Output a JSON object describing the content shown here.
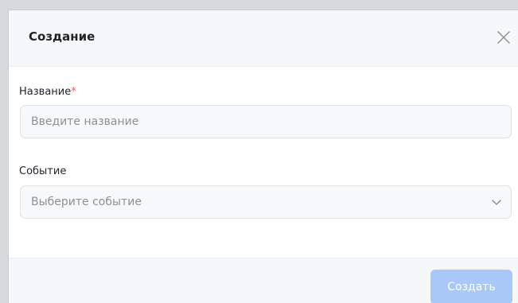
{
  "dialog": {
    "title": "Создание",
    "close_icon": "close-icon"
  },
  "form": {
    "name_field": {
      "label": "Название",
      "required_marker": "*",
      "value": "",
      "placeholder": "Введите название"
    },
    "event_field": {
      "label": "Событие",
      "selected": "Выберите событие",
      "chevron_icon": "chevron-down-icon"
    }
  },
  "footer": {
    "create_label": "Создать",
    "create_enabled": false
  },
  "colors": {
    "primary_disabled": "#a9c8f7",
    "required": "#ef5b5b",
    "header_bg": "#f6f7f8"
  }
}
